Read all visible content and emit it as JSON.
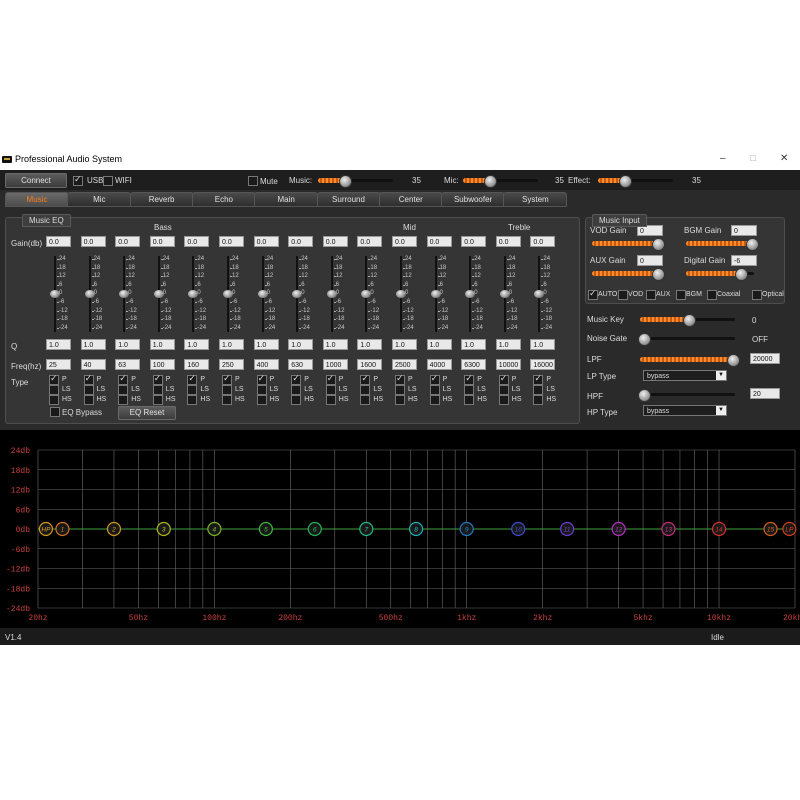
{
  "window": {
    "title": "Professional Audio System",
    "minimize": "–",
    "maximize": "□",
    "close": "✕"
  },
  "toolbar": {
    "connect": "Connect",
    "usb": "USB",
    "wifi": "WIFI",
    "mute": "Mute",
    "music_label": "Music:",
    "music_value": "35",
    "music_level": 0.35,
    "mic_label": "Mic:",
    "mic_value": "35",
    "mic_level": 0.35,
    "effect_label": "Effect:",
    "effect_value": "35",
    "effect_level": 0.35
  },
  "tabs": [
    "Music",
    "Mic",
    "Reverb",
    "Echo",
    "Main",
    "Surround",
    "Center",
    "Subwoofer",
    "System"
  ],
  "eq": {
    "group_title": "Music EQ",
    "section_labels": {
      "bass": "Bass",
      "mid": "Mid",
      "treble": "Treble"
    },
    "row_labels": {
      "gain": "Gain(db)",
      "q": "Q",
      "freq": "Freq(hz)",
      "type": "Type"
    },
    "gains": [
      "0.0",
      "0.0",
      "0.0",
      "0.0",
      "0.0",
      "0.0",
      "0.0",
      "0.0",
      "0.0",
      "0.0",
      "0.0",
      "0.0",
      "0.0",
      "0.0",
      "0.0"
    ],
    "qs": [
      "1.0",
      "1.0",
      "1.0",
      "1.0",
      "1.0",
      "1.0",
      "1.0",
      "1.0",
      "1.0",
      "1.0",
      "1.0",
      "1.0",
      "1.0",
      "1.0",
      "1.0"
    ],
    "freqs": [
      "25",
      "40",
      "63",
      "100",
      "160",
      "250",
      "400",
      "630",
      "1000",
      "1600",
      "2500",
      "4000",
      "6300",
      "10000",
      "16000"
    ],
    "type_options": [
      "P",
      "LS",
      "HS"
    ],
    "scale_ticks": [
      "24",
      "18",
      "12",
      "6",
      "0",
      "-6",
      "-12",
      "-18",
      "-24"
    ],
    "eq_bypass": "EQ Bypass",
    "eq_reset": "EQ Reset"
  },
  "music_input": {
    "group_title": "Music Input",
    "vod_gain_label": "VOD Gain",
    "vod_gain": "0",
    "bgm_gain_label": "BGM Gain",
    "bgm_gain": "0",
    "aux_gain_label": "AUX Gain",
    "aux_gain": "0",
    "digital_gain_label": "Digital Gain",
    "digital_gain": "-6",
    "sources": [
      "AUTO",
      "VOD",
      "AUX",
      "BGM",
      "Coaxial",
      "Optical"
    ],
    "sources_checked": [
      true,
      false,
      false,
      false,
      false,
      false
    ]
  },
  "side": {
    "music_key_label": "Music Key",
    "music_key": "0",
    "music_key_level": 0.5,
    "noise_gate_label": "Noise Gate",
    "noise_gate": "OFF",
    "lpf_label": "LPF",
    "lpf": "20000",
    "lp_type_label": "LP Type",
    "lp_type": "bypass",
    "hpf_label": "HPF",
    "hpf": "20",
    "hp_type_label": "HP Type",
    "hp_type": "bypass"
  },
  "graph": {
    "y_ticks": [
      "24db",
      "18db",
      "12db",
      "6db",
      "0db",
      "-6db",
      "-12db",
      "-18db",
      "-24db"
    ],
    "x_ticks": [
      "20hz",
      "50hz",
      "100hz",
      "200hz",
      "500hz",
      "1khz",
      "2khz",
      "5khz",
      "10khz",
      "20khz"
    ],
    "points": [
      {
        "label": "HP",
        "color": "#e0a020",
        "freq": 20
      },
      {
        "label": "1",
        "color": "#e07a20",
        "freq": 25
      },
      {
        "label": "2",
        "color": "#d8a020",
        "freq": 40
      },
      {
        "label": "3",
        "color": "#b8c020",
        "freq": 63
      },
      {
        "label": "4",
        "color": "#80c020",
        "freq": 100
      },
      {
        "label": "5",
        "color": "#40c040",
        "freq": 160
      },
      {
        "label": "6",
        "color": "#20c060",
        "freq": 250
      },
      {
        "label": "7",
        "color": "#20c090",
        "freq": 400
      },
      {
        "label": "8",
        "color": "#20b8c0",
        "freq": 630
      },
      {
        "label": "9",
        "color": "#2080d0",
        "freq": 1000
      },
      {
        "label": "10",
        "color": "#4050e0",
        "freq": 1600
      },
      {
        "label": "11",
        "color": "#7040e0",
        "freq": 2500
      },
      {
        "label": "12",
        "color": "#c030d0",
        "freq": 4000
      },
      {
        "label": "13",
        "color": "#d03080",
        "freq": 6300
      },
      {
        "label": "14",
        "color": "#e03030",
        "freq": 10000
      },
      {
        "label": "15",
        "color": "#e06020",
        "freq": 16000
      },
      {
        "label": "LP",
        "color": "#e04020",
        "freq": 20000
      }
    ]
  },
  "status": {
    "version": "V1.4",
    "state": "Idle"
  }
}
